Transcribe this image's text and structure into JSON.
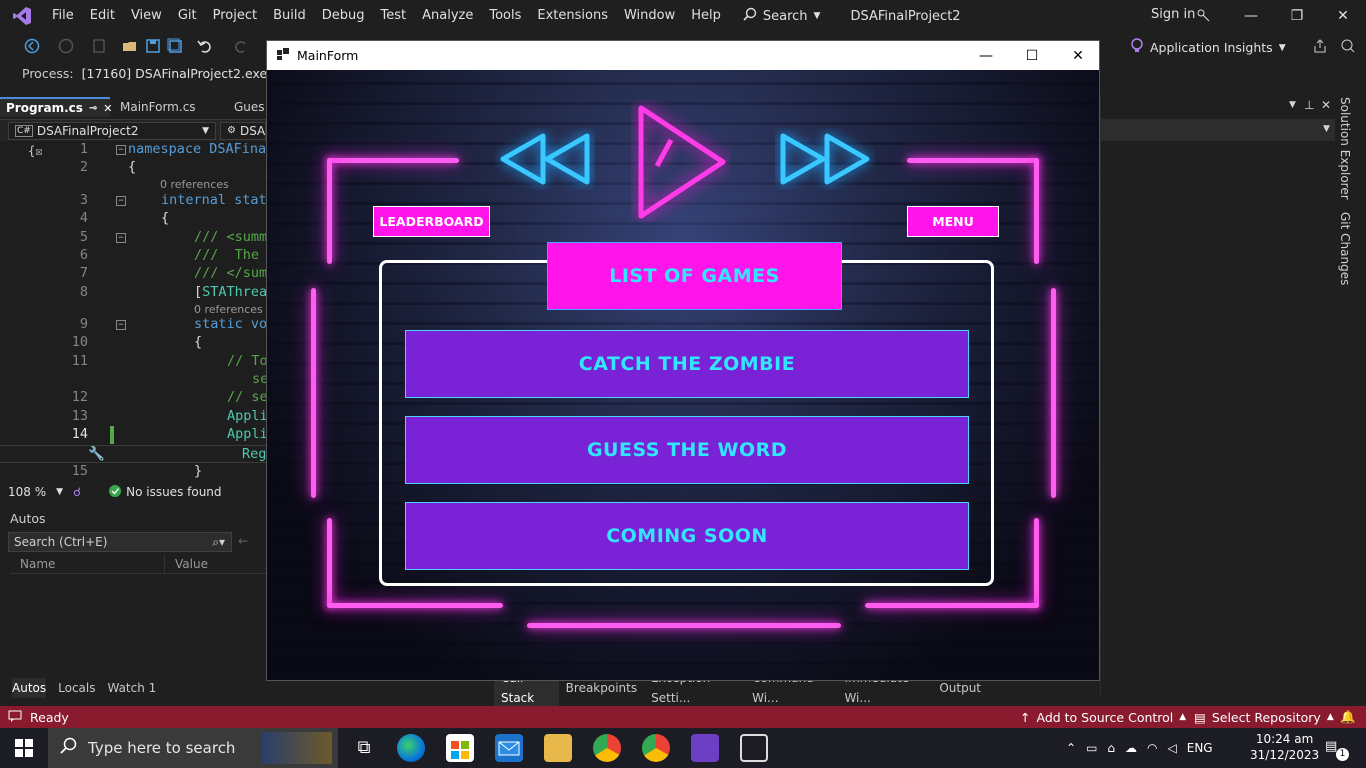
{
  "vs": {
    "menu": [
      "File",
      "Edit",
      "View",
      "Git",
      "Project",
      "Build",
      "Debug",
      "Test",
      "Analyze",
      "Tools",
      "Extensions",
      "Window",
      "Help"
    ],
    "search_label": "Search",
    "solution_name": "DSAFinalProject2",
    "signin": "Sign in",
    "app_insights": "Application Insights",
    "process_label": "Process:",
    "process_value": "[17160] DSAFinalProject2.exe",
    "tabs": [
      "Program.cs",
      "MainForm.cs",
      "Gues"
    ],
    "nav_project": "DSAFinalProject2",
    "nav_class": "DSA",
    "code": {
      "l1": "namespace DSAFina",
      "l2": "{",
      "r3": "0 references",
      "l3a": "internal",
      "l3b": " stat",
      "l4": "{",
      "l5": "/// <summ",
      "l6": "///  The",
      "l7": "/// </sum",
      "l8a": "[",
      "l8b": "STAThrea",
      "r9": "0 references",
      "l9a": "static",
      "l9b": " vo",
      "l10": "{",
      "l11a": "// To",
      "l11b": "se",
      "l12": "// se",
      "l13": "Appli",
      "l14": "Appli",
      "l14b": "Reg",
      "l15": "}"
    },
    "line_numbers": [
      "1",
      "2",
      "3",
      "4",
      "5",
      "6",
      "7",
      "8",
      "9",
      "10",
      "11",
      "12",
      "13",
      "14",
      "15"
    ],
    "zoom": "108 %",
    "issues": "No issues found",
    "autos_title": "Autos",
    "autos_search": "Search (Ctrl+E)",
    "autos_col_name": "Name",
    "autos_col_value": "Value",
    "bottom_tabs_left": [
      "Autos",
      "Locals",
      "Watch 1"
    ],
    "bottom_tabs_right": [
      "Call Stack",
      "Breakpoints",
      "Exception Setti...",
      "Command Wi...",
      "Immediate Wi...",
      "Output"
    ],
    "side_tabs": [
      "Solution Explorer",
      "Git Changes"
    ],
    "status_ready": "Ready",
    "status_src": "Add to Source Control",
    "status_repo": "Select Repository"
  },
  "taskbar": {
    "search_placeholder": "Type here to search",
    "lang": "ENG",
    "time": "10:24 am",
    "date": "31/12/2023",
    "notif_count": "1"
  },
  "mainform": {
    "title": "MainForm",
    "leaderboard": "LEADERBOARD",
    "menu": "MENU",
    "games_header": "List of Games",
    "games": [
      "Catch the Zombie",
      "Guess the Word",
      "Coming Soon"
    ]
  },
  "colors": {
    "neon_pink": "#ff14ea",
    "game_button": "#7a22d6",
    "game_text": "#33e6ff",
    "status_bar": "#8a1a2e"
  }
}
